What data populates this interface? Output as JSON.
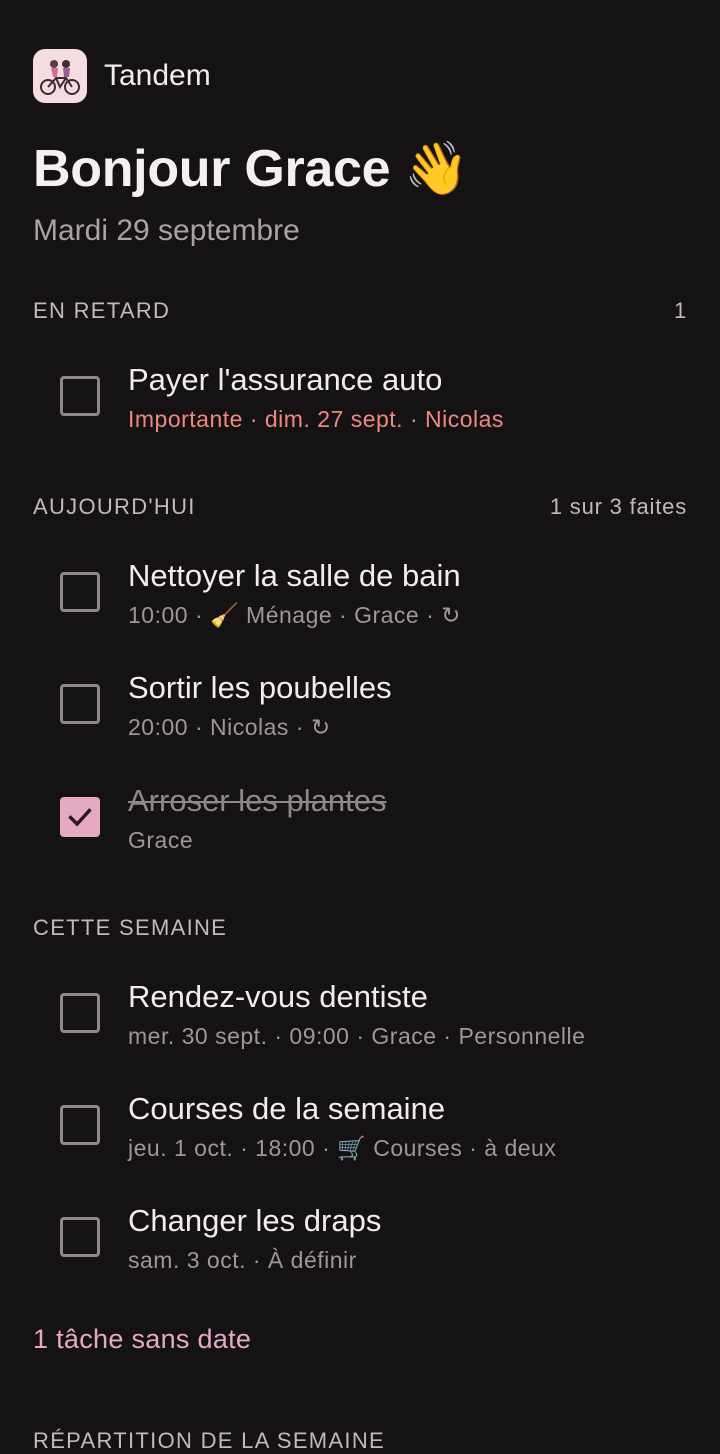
{
  "app": {
    "name": "Tandem",
    "logo_icon": "couple-tandem-bike-icon"
  },
  "greeting": {
    "text": "Bonjour Grace",
    "emoji": "👋",
    "date": "Mardi 29 septembre"
  },
  "colors": {
    "accent": "#E5A9C4",
    "overdue": "#EE8A84",
    "background": "#141213"
  },
  "sections": {
    "overdue": {
      "title": "EN RETARD",
      "count": "1",
      "tasks": [
        {
          "title": "Payer l'assurance auto",
          "meta": "Importante · dim. 27 sept. · Nicolas",
          "done": false
        }
      ]
    },
    "today": {
      "title": "AUJOURD'HUI",
      "count": "1 sur 3 faites",
      "tasks": [
        {
          "title": "Nettoyer la salle de bain",
          "meta_before": "10:00 · ",
          "meta_icon": "🧹",
          "meta_after": " Ménage · Grace · ",
          "repeat_icon": "↻",
          "done": false
        },
        {
          "title": "Sortir les poubelles",
          "meta_before": "20:00 · Nicolas · ",
          "repeat_icon": "↻",
          "done": false
        },
        {
          "title": "Arroser les plantes",
          "meta": "Grace",
          "done": true
        }
      ]
    },
    "week": {
      "title": "CETTE SEMAINE",
      "tasks": [
        {
          "title": "Rendez-vous dentiste",
          "meta": "mer. 30 sept. · 09:00 · Grace · Personnelle",
          "done": false
        },
        {
          "title": "Courses de la semaine",
          "meta_before": "jeu. 1 oct. · 18:00 · ",
          "meta_icon": "🛒",
          "meta_after": " Courses · à deux",
          "done": false
        },
        {
          "title": "Changer les draps",
          "meta": "sam. 3 oct. · À définir",
          "done": false
        }
      ]
    },
    "breakdown": {
      "title": "RÉPARTITION DE LA SEMAINE"
    }
  },
  "undated_link": "1 tâche sans date"
}
